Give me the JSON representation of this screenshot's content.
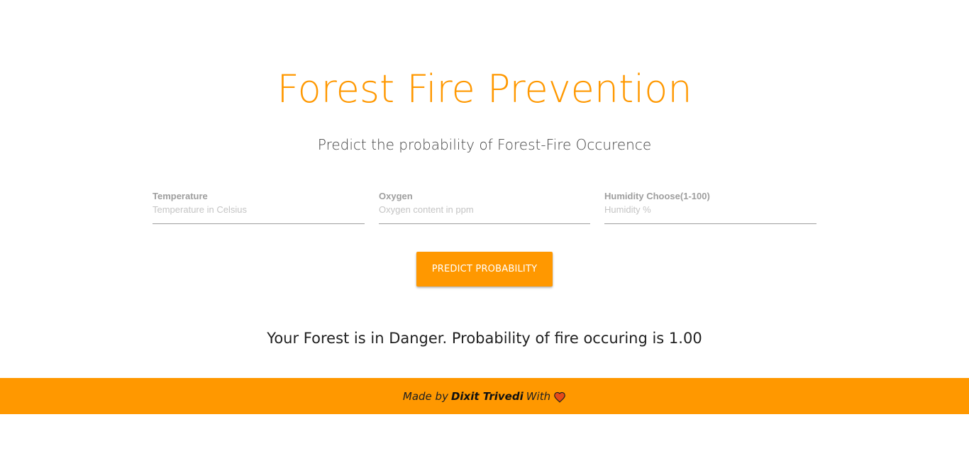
{
  "header": {
    "title": "Forest Fire Prevention",
    "subtitle": "Predict the probability of Forest-Fire Occurence"
  },
  "form": {
    "fields": [
      {
        "label": "Temperature",
        "placeholder": "Temperature in Celsius",
        "value": ""
      },
      {
        "label": "Oxygen",
        "placeholder": "Oxygen content in ppm",
        "value": ""
      },
      {
        "label": "Humidity Choose(1-100)",
        "placeholder": "Humidity %",
        "value": ""
      }
    ],
    "submit_label": "Predict Probability"
  },
  "result": {
    "text": "Your Forest is in Danger. Probability of fire occuring is 1.00"
  },
  "footer": {
    "prefix": "Made by",
    "author": "Dixit Trivedi",
    "suffix": "With",
    "icon": "heart-icon"
  },
  "colors": {
    "accent": "#ff9800",
    "text": "#212121",
    "label": "#9e9e9e"
  }
}
